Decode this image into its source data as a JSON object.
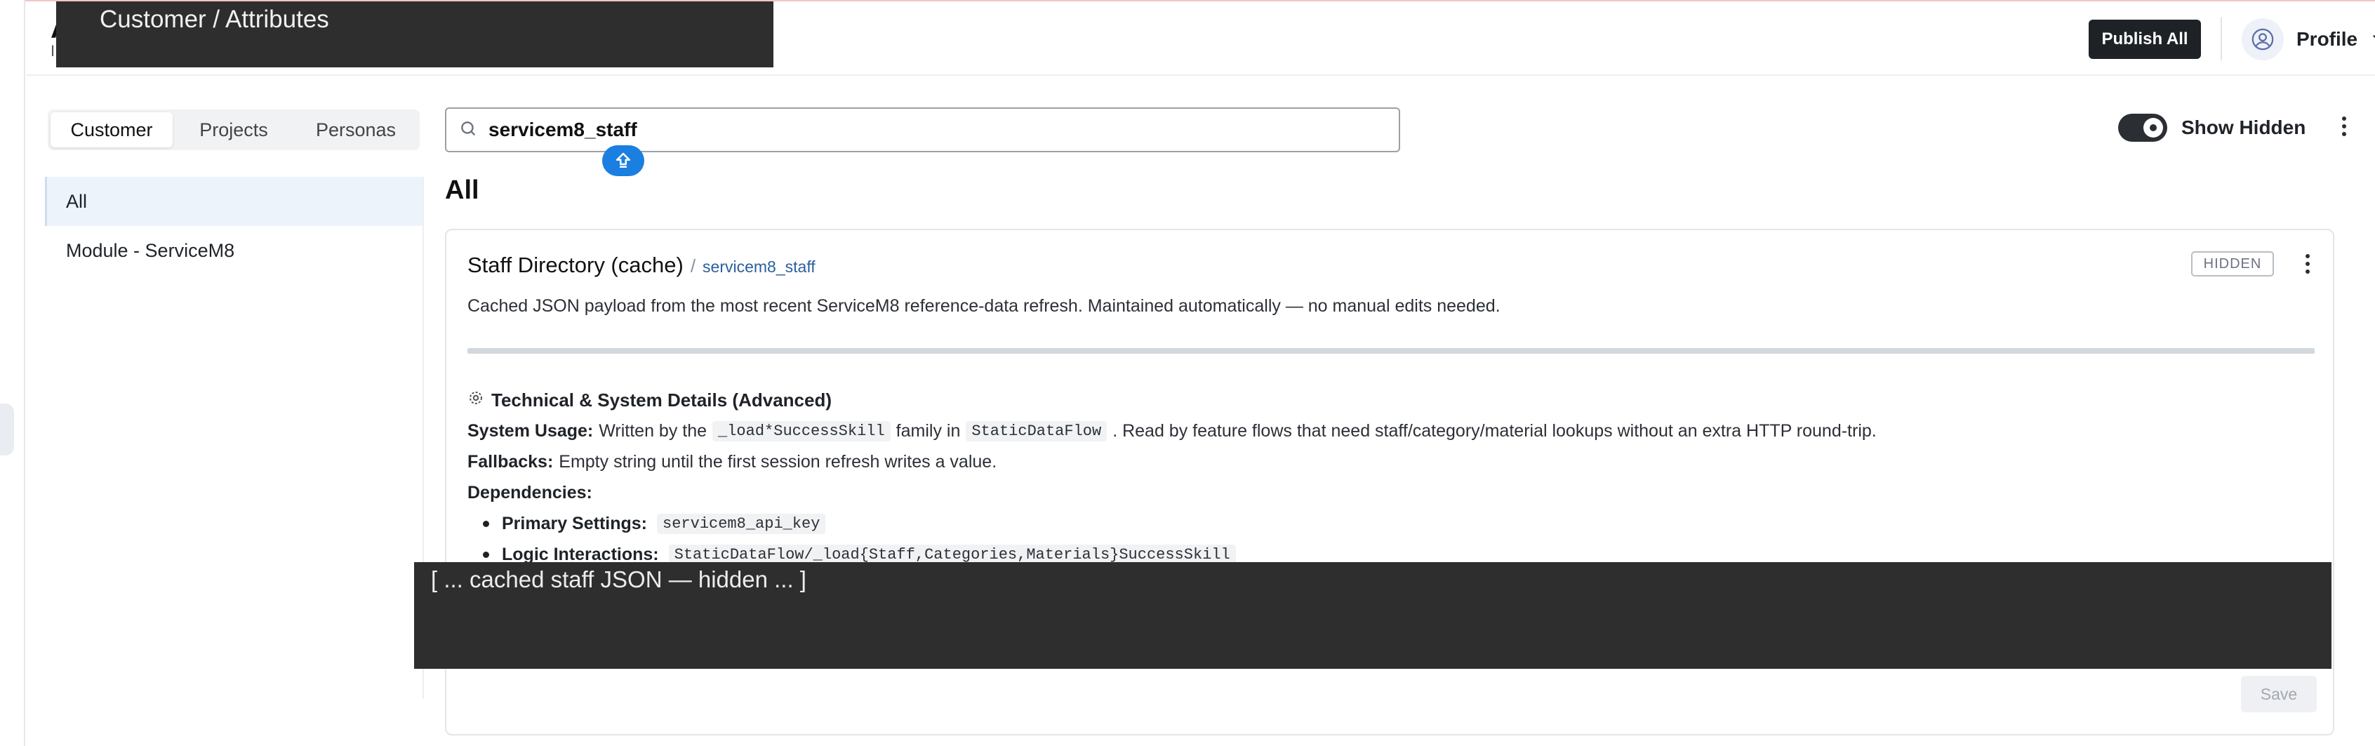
{
  "header": {
    "title_background": "A",
    "subtitle_background": "I",
    "breadcrumb": "Customer / Attributes",
    "publish_label": "Publish All",
    "profile_label": "Profile"
  },
  "tabs": [
    {
      "label": "Customer",
      "active": true
    },
    {
      "label": "Projects",
      "active": false
    },
    {
      "label": "Personas",
      "active": false
    }
  ],
  "sidebar": {
    "items": [
      {
        "label": "All",
        "active": true
      },
      {
        "label": "Module - ServiceM8",
        "active": false
      }
    ]
  },
  "search": {
    "value": "servicem8_staff",
    "icon": "search-icon"
  },
  "toggle": {
    "label": "Show Hidden",
    "on": true
  },
  "main": {
    "section_title": "All"
  },
  "card": {
    "title": "Staff Directory (cache)",
    "slash": "/",
    "key": "servicem8_staff",
    "badge": "HIDDEN",
    "description": "Cached JSON payload from the most recent ServiceM8 reference-data refresh. Maintained automatically — no manual edits needed.",
    "tech": {
      "heading": "Technical & System Details (Advanced)",
      "system_usage_label": "System Usage:",
      "system_usage_pre": "Written by the",
      "system_usage_code1": "_load*SuccessSkill",
      "system_usage_mid": "family in",
      "system_usage_code2": "StaticDataFlow",
      "system_usage_post": ". Read by feature flows that need staff/category/material lookups without an extra HTTP round-trip.",
      "fallbacks_label": "Fallbacks:",
      "fallbacks_text": "Empty string until the first session refresh writes a value.",
      "dependencies_label": "Dependencies:",
      "primary_label": "Primary Settings:",
      "primary_code": "servicem8_api_key",
      "logic_label": "Logic Interactions:",
      "logic_code": "StaticDataFlow/_load{Staff,Categories,Materials}SuccessSkill"
    },
    "overlay_text": "[ ... cached staff JSON — hidden ... ]",
    "save_label": "Save"
  },
  "colors": {
    "accent_blue": "#1a7fe0",
    "dark_button": "#1e2227",
    "active_nav_bg": "#edf3fb",
    "key_link": "#2b5f9e"
  }
}
